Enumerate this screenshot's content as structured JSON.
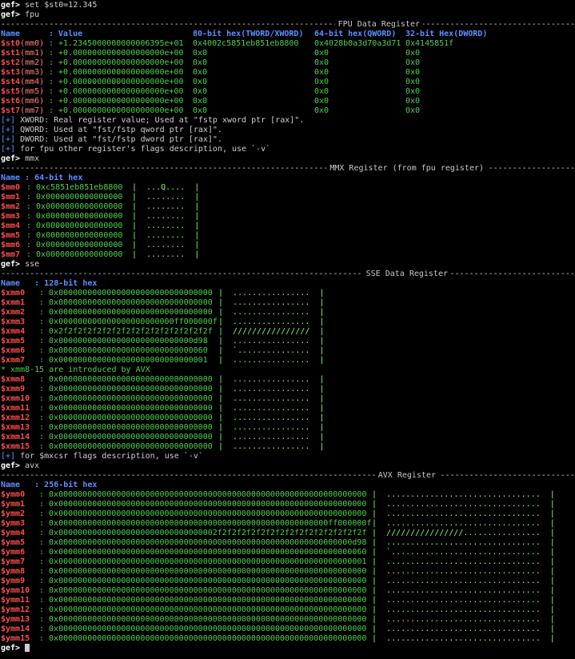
{
  "prompt": "gef>",
  "commands": [
    "set $st0=12.345",
    "fpu",
    "mmx",
    "sse",
    "avx"
  ],
  "fpu": {
    "title": "FPU Data Register",
    "headers": [
      "Name",
      ": Value",
      "80-bit hex(TWORD/XWORD)",
      "64-bit hex(QWORD)",
      "32-bit Hex(DWORD)"
    ],
    "rows": [
      {
        "name": "$st0",
        "alias": "(mm0)",
        "value": ": +1.2345000000000006395e+01",
        "h80": "0x4002c5851eb851eb8800",
        "h64": "0x4028b0a3d70a3d71",
        "h32": "0x4145851f"
      },
      {
        "name": "$st1",
        "alias": "(mm1)",
        "value": ": +0.0000000000000000000e+00",
        "h80": "0x0",
        "h64": "0x0",
        "h32": "0x0"
      },
      {
        "name": "$st2",
        "alias": "(mm2)",
        "value": ": +0.0000000000000000000e+00",
        "h80": "0x0",
        "h64": "0x0",
        "h32": "0x0"
      },
      {
        "name": "$st3",
        "alias": "(mm3)",
        "value": ": +0.0000000000000000000e+00",
        "h80": "0x0",
        "h64": "0x0",
        "h32": "0x0"
      },
      {
        "name": "$st4",
        "alias": "(mm4)",
        "value": ": +0.0000000000000000000e+00",
        "h80": "0x0",
        "h64": "0x0",
        "h32": "0x0"
      },
      {
        "name": "$st5",
        "alias": "(mm5)",
        "value": ": +0.0000000000000000000e+00",
        "h80": "0x0",
        "h64": "0x0",
        "h32": "0x0"
      },
      {
        "name": "$st6",
        "alias": "(mm6)",
        "value": ": +0.0000000000000000000e+00",
        "h80": "0x0",
        "h64": "0x0",
        "h32": "0x0"
      },
      {
        "name": "$st7",
        "alias": "(mm7)",
        "value": ": +0.0000000000000000000e+00",
        "h80": "0x0",
        "h64": "0x0",
        "h32": "0x0"
      }
    ],
    "notes": [
      {
        "tag": "[+]",
        "text": " XWORD: Real register value; Used at \"fstp xword ptr [rax]\"."
      },
      {
        "tag": "[+]",
        "text": " QWORD: Used at \"fst/fstp qword ptr [rax]\"."
      },
      {
        "tag": "[+]",
        "text": " DWORD: Used at \"fst/fstp dword ptr [rax]\"."
      },
      {
        "tag": "[+]",
        "text": " for fpu other register's flags description, use `-v`"
      }
    ]
  },
  "mmx": {
    "title": "MMX Register (from fpu register)",
    "header": "Name : 64-bit hex",
    "rows": [
      {
        "name": "$mm0",
        "hex": ": 0xc5851eb851eb8800",
        "ascii": "|  ...Q....  |"
      },
      {
        "name": "$mm1",
        "hex": ": 0x0000000000000000",
        "ascii": "|  ........  |"
      },
      {
        "name": "$mm2",
        "hex": ": 0x0000000000000000",
        "ascii": "|  ........  |"
      },
      {
        "name": "$mm3",
        "hex": ": 0x0000000000000000",
        "ascii": "|  ........  |"
      },
      {
        "name": "$mm4",
        "hex": ": 0x0000000000000000",
        "ascii": "|  ........  |"
      },
      {
        "name": "$mm5",
        "hex": ": 0x0000000000000000",
        "ascii": "|  ........  |"
      },
      {
        "name": "$mm6",
        "hex": ": 0x0000000000000000",
        "ascii": "|  ........  |"
      },
      {
        "name": "$mm7",
        "hex": ": 0x0000000000000000",
        "ascii": "|  ........  |"
      }
    ]
  },
  "sse": {
    "title": "SSE Data Register",
    "header": "Name   : 128-bit hex",
    "rows": [
      {
        "name": "$xmm0",
        "hex": ": 0x00000000000000000000000000000000",
        "ascii": "|  ................  |"
      },
      {
        "name": "$xmm1",
        "hex": ": 0x00000000000000000000000000000000",
        "ascii": "|  ................  |"
      },
      {
        "name": "$xmm2",
        "hex": ": 0x00000000000000000000000000000000",
        "ascii": "|  ................  |"
      },
      {
        "name": "$xmm3",
        "hex": ": 0x000000000000000000000000ff000000ff",
        "ascii": "|  ................  |"
      },
      {
        "name": "$xmm4",
        "hex": ": 0x2f2f2f2f2f2f2f2f2f2f2f2f2f2f2f2f",
        "ascii": "|  ////////////////  |"
      },
      {
        "name": "$xmm5",
        "hex": ": 0x0000000000000000000000000000d98",
        "ascii": "|  ................  |"
      },
      {
        "name": "$xmm6",
        "hex": ": 0x0000000000000000000000000000060",
        "ascii": "|  `...............  |"
      },
      {
        "name": "$xmm7",
        "hex": ": 0x0000000000000000000000000000001",
        "ascii": "|  ................  |"
      }
    ],
    "avx_note": "* xmm8-15 are introduced by AVX",
    "rows2": [
      {
        "name": "$xmm8",
        "hex": ": 0x00000000000000000000000000000000",
        "ascii": "|  ................  |"
      },
      {
        "name": "$xmm9",
        "hex": ": 0x00000000000000000000000000000000",
        "ascii": "|  ................  |"
      },
      {
        "name": "$xmm10",
        "hex": ": 0x00000000000000000000000000000000",
        "ascii": "|  ................  |"
      },
      {
        "name": "$xmm11",
        "hex": ": 0x00000000000000000000000000000000",
        "ascii": "|  ................  |"
      },
      {
        "name": "$xmm12",
        "hex": ": 0x00000000000000000000000000000000",
        "ascii": "|  ................  |"
      },
      {
        "name": "$xmm13",
        "hex": ": 0x00000000000000000000000000000000",
        "ascii": "|  ................  |"
      },
      {
        "name": "$xmm14",
        "hex": ": 0x00000000000000000000000000000000",
        "ascii": "|  ................  |"
      },
      {
        "name": "$xmm15",
        "hex": ": 0x00000000000000000000000000000000",
        "ascii": "|  ................  |"
      }
    ],
    "note": {
      "tag": "[+]",
      "text": " for $mxcsr flags description, use `-v`"
    }
  },
  "avx": {
    "title": "AVX Register",
    "header": "Name   : 256-bit hex",
    "rows": [
      {
        "name": "$ymm0",
        "hex": ": 0x0000000000000000000000000000000000000000000000000000000000000000",
        "ascii": "|  ................................  |"
      },
      {
        "name": "$ymm1",
        "hex": ": 0x0000000000000000000000000000000000000000000000000000000000000000",
        "ascii": "|  ................................  |"
      },
      {
        "name": "$ymm2",
        "hex": ": 0x0000000000000000000000000000000000000000000000000000000000000000",
        "ascii": "|  ................................  |"
      },
      {
        "name": "$ymm3",
        "hex": ": 0x00000000000000000000000000000000000000000000000000000000ff000000ff",
        "ascii": "|  ................................  |"
      },
      {
        "name": "$ymm4",
        "hex": ": 0x000000000000000000000000000000002f2f2f2f2f2f2f2f2f2f2f2f2f2f2f2f",
        "ascii": "|  ////////////////................  |"
      },
      {
        "name": "$ymm5",
        "hex": ": 0x0000000000000000000000000000000000000000000000000000000000000d98",
        "ascii": "|  ................................  |"
      },
      {
        "name": "$ymm6",
        "hex": ": 0x0000000000000000000000000000000000000000000000000000000000000060",
        "ascii": "|  `...............................  |"
      },
      {
        "name": "$ymm7",
        "hex": ": 0x0000000000000000000000000000000000000000000000000000000000000001",
        "ascii": "|  ................................  |"
      },
      {
        "name": "$ymm8",
        "hex": ": 0x0000000000000000000000000000000000000000000000000000000000000000",
        "ascii": "|  ................................  |"
      },
      {
        "name": "$ymm9",
        "hex": ": 0x0000000000000000000000000000000000000000000000000000000000000000",
        "ascii": "|  ................................  |"
      },
      {
        "name": "$ymm10",
        "hex": ": 0x0000000000000000000000000000000000000000000000000000000000000000",
        "ascii": "|  ................................  |"
      },
      {
        "name": "$ymm11",
        "hex": ": 0x0000000000000000000000000000000000000000000000000000000000000000",
        "ascii": "|  ................................  |"
      },
      {
        "name": "$ymm12",
        "hex": ": 0x0000000000000000000000000000000000000000000000000000000000000000",
        "ascii": "|  ................................  |"
      },
      {
        "name": "$ymm13",
        "hex": ": 0x0000000000000000000000000000000000000000000000000000000000000000",
        "ascii": "|  ................................  |"
      },
      {
        "name": "$ymm14",
        "hex": ": 0x0000000000000000000000000000000000000000000000000000000000000000",
        "ascii": "|  ................................  |"
      },
      {
        "name": "$ymm15",
        "hex": ": 0x0000000000000000000000000000000000000000000000000000000000000000",
        "ascii": "|  ................................  |"
      }
    ]
  },
  "colors": {
    "background": "#000000",
    "register": "#ff4d4d",
    "value": "#4fd04f",
    "header": "#5f8fff"
  }
}
